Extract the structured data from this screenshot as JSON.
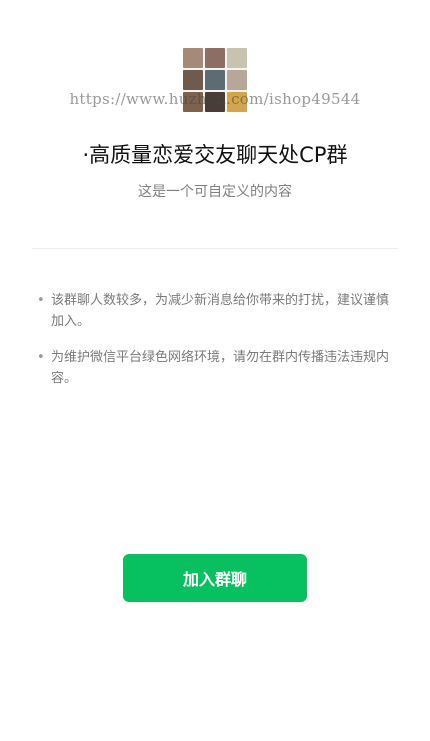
{
  "group": {
    "avatar_colors": [
      "#a68a78",
      "#8c6e62",
      "#c9c2b0",
      "#6f5a4e",
      "#5d6b73",
      "#b7a79a",
      "#7d6250",
      "#4a3c36",
      "#d4a64a"
    ],
    "title": "·高质量恋爱交友聊天处CP群",
    "subtitle": "这是一个可自定义的内容"
  },
  "watermark": "https://www.huzhan.com/ishop49544",
  "notices": [
    {
      "text": "该群聊人数较多，为减少新消息给你带来的打扰，建议谨慎加入。"
    },
    {
      "text": "为维护微信平台绿色网络环境，请勿在群内传播违法违规内容。"
    }
  ],
  "bullet_symbol": "•",
  "join_button": {
    "label": "加入群聊",
    "color": "#07c160"
  }
}
